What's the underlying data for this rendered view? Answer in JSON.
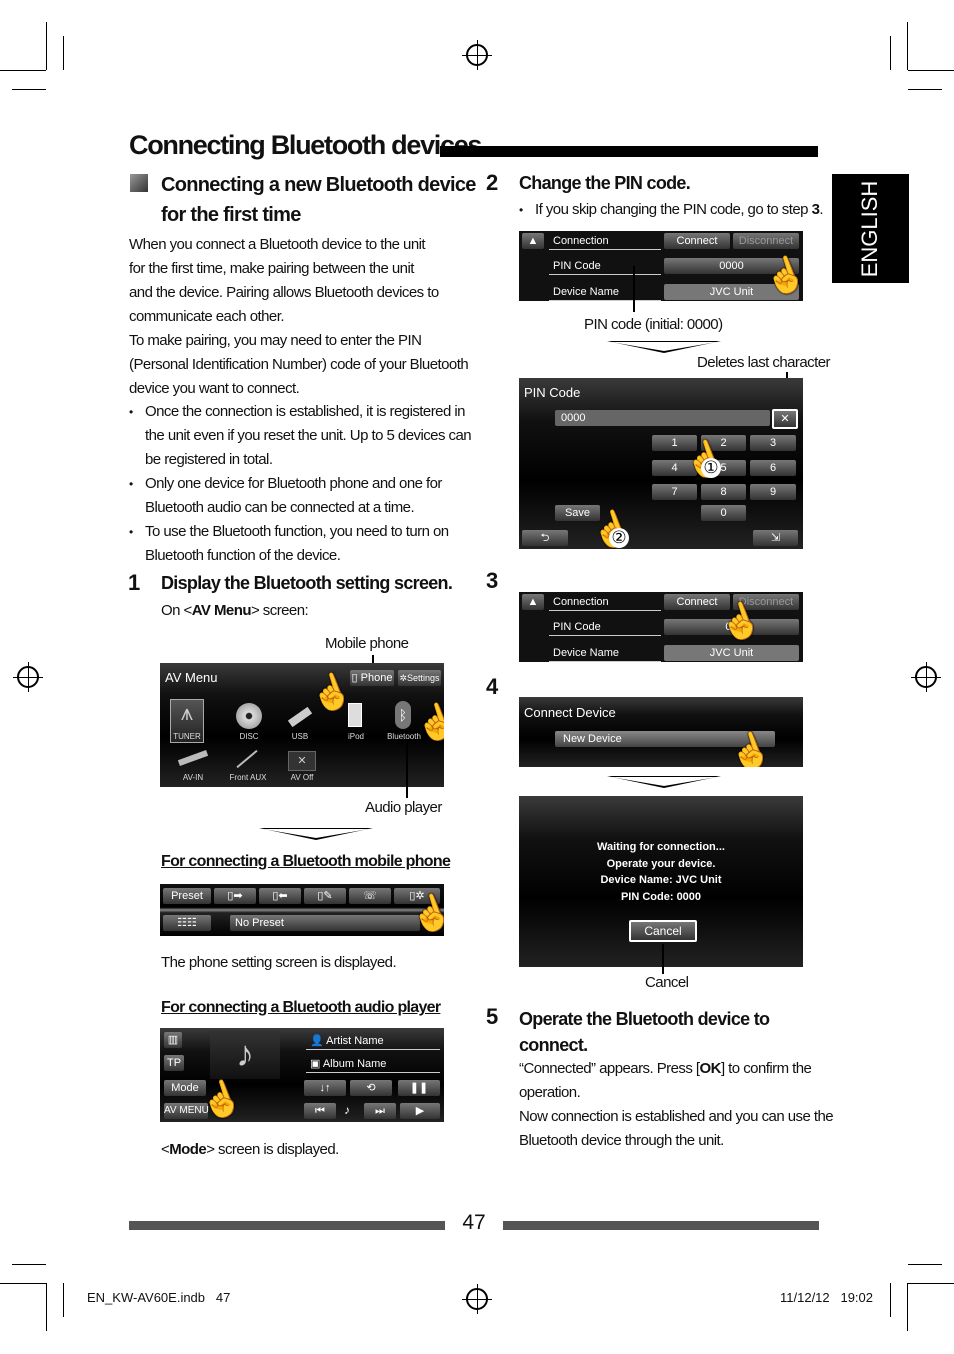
{
  "page_title": "Connecting Bluetooth devices",
  "section_heading": [
    "Connecting a new Bluetooth device",
    "for the first time"
  ],
  "intro": [
    [
      "When you connect a Bluetooth device to the unit",
      "for the first time, make pairing between the unit",
      "and the device. Pairing allows Bluetooth devices to",
      "communicate each other."
    ],
    [
      "To make pairing, you may need to enter the PIN",
      "(Personal Identification Number) code of your Bluetooth",
      "device you want to connect."
    ]
  ],
  "bullets": [
    [
      "Once the connection is established, it is registered in",
      "the unit even if you reset the unit. Up to 5 devices can",
      "be registered in total."
    ],
    [
      "Only one device for Bluetooth phone and one for",
      "Bluetooth audio can be connected at a time."
    ],
    [
      "To use the Bluetooth function, you need to turn on",
      "Bluetooth function of the device."
    ]
  ],
  "step1": {
    "num": "1",
    "title": "Display the Bluetooth setting screen.",
    "sub_pre": "On <",
    "sub_bold": "AV Menu",
    "sub_post": "> screen:"
  },
  "av_menu": {
    "title": "AV Menu",
    "phone": "Phone",
    "settings": "Settings",
    "items": [
      "TUNER",
      "DISC",
      "USB",
      "iPod",
      "Bluetooth",
      "AV-IN",
      "Front AUX",
      "AV Off"
    ],
    "callout_top": "Mobile phone",
    "callout_bottom": "Audio player"
  },
  "phone_section": {
    "heading": "For connecting a Bluetooth mobile phone",
    "preset": "Preset",
    "no_preset": "No Preset",
    "caption": "The phone setting screen is displayed."
  },
  "audio_section": {
    "heading": "For connecting a Bluetooth audio player",
    "tp": "TP",
    "mode": "Mode",
    "av_menu": "AV MENU",
    "artist": "Artist Name",
    "album": "Album Name",
    "caption_pre": "<",
    "caption_bold": "Mode",
    "caption_post": "> screen is displayed."
  },
  "step2": {
    "num": "2",
    "title": "Change the PIN code.",
    "bullet_pre": "If you skip changing the PIN code, go to step ",
    "bullet_bold": "3",
    "bullet_post": "."
  },
  "settings_screen": {
    "connection": "Connection",
    "connect": "Connect",
    "disconnect": "Disconnect",
    "pin_code": "PIN Code",
    "pin_value": "0000",
    "pin_value_partial": "00",
    "device_name": "Device Name",
    "device_value": "JVC Unit"
  },
  "pin_callout": "PIN code (initial: 0000)",
  "delete_callout": "Deletes last character",
  "pin_screen": {
    "title": "PIN Code",
    "value": "0000",
    "keys": [
      "1",
      "2",
      "3",
      "4",
      "5",
      "6",
      "7",
      "8",
      "9",
      "0"
    ],
    "save": "Save",
    "marker1": "①",
    "marker2": "②"
  },
  "step3": {
    "num": "3"
  },
  "step4": {
    "num": "4",
    "connect_title": "Connect Device",
    "new_device": "New Device",
    "waiting": [
      "Waiting for connection...",
      "Operate your device.",
      "Device Name: JVC Unit",
      "PIN Code: 0000"
    ],
    "cancel": "Cancel",
    "cancel_callout": "Cancel"
  },
  "step5": {
    "num": "5",
    "title": [
      "Operate the Bluetooth device to",
      "connect."
    ],
    "p1_pre": "“Connected” appears. Press [",
    "p1_bold": "OK",
    "p1_post": "] to confirm the",
    "p1_line2": "operation.",
    "p2": [
      "Now connection is established and you can use the",
      "Bluetooth device through the unit."
    ]
  },
  "side_tab": "ENGLISH",
  "footer": {
    "page": "47",
    "file": "EN_KW-AV60E.indb   47",
    "date": "11/12/12   19:02"
  }
}
